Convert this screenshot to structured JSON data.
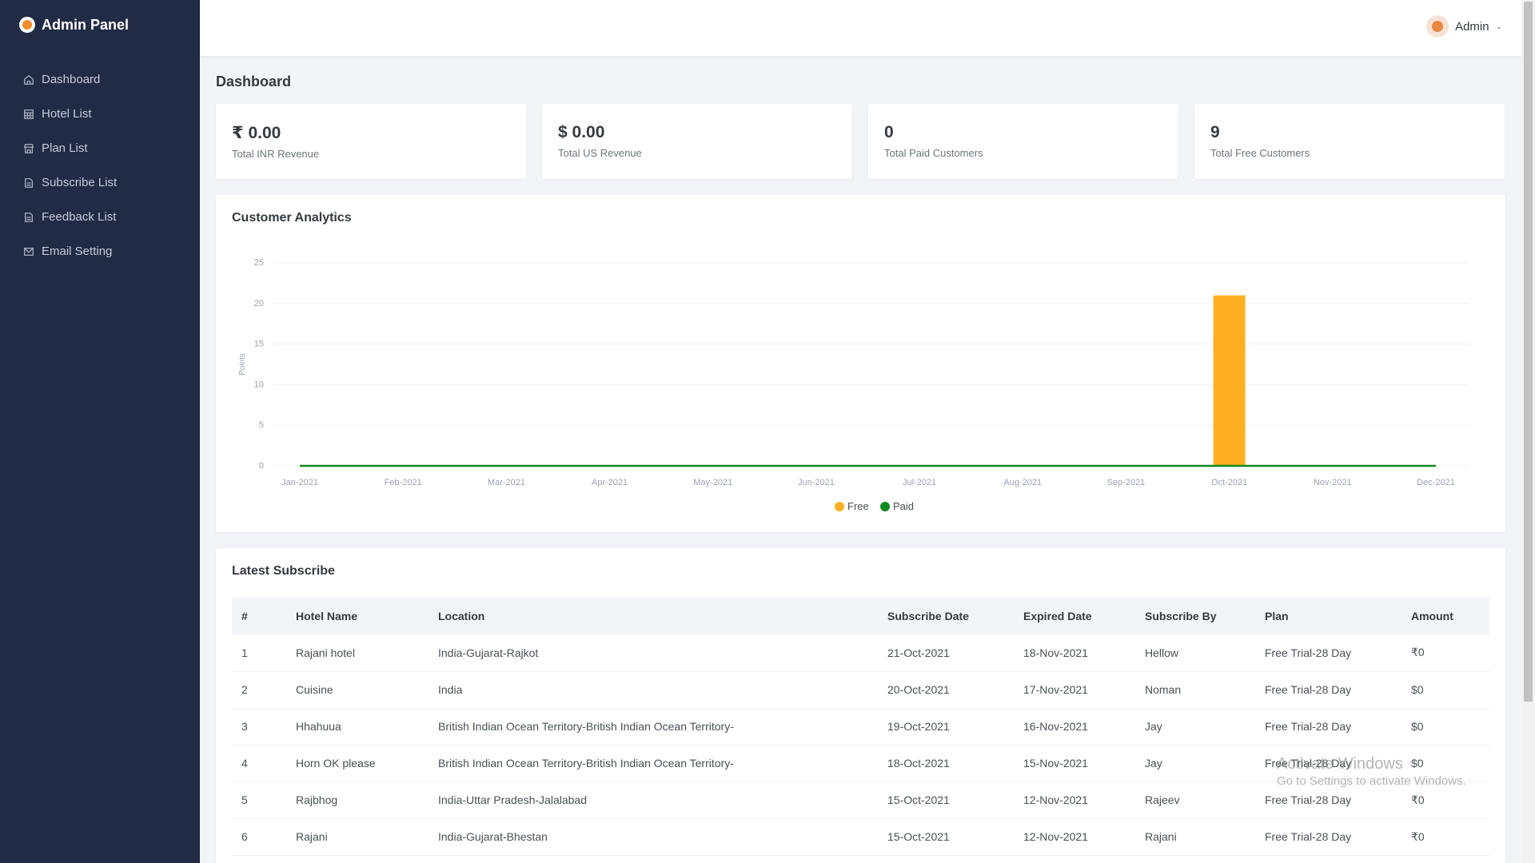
{
  "brand": {
    "title": "Admin Panel",
    "logo_icon": "restaurant-logo-icon"
  },
  "sidebar": {
    "items": [
      {
        "label": "Dashboard",
        "icon": "home-icon"
      },
      {
        "label": "Hotel List",
        "icon": "table-icon"
      },
      {
        "label": "Plan List",
        "icon": "store-icon"
      },
      {
        "label": "Subscribe List",
        "icon": "document-icon"
      },
      {
        "label": "Feedback List",
        "icon": "document-icon"
      },
      {
        "label": "Email Setting",
        "icon": "mail-icon"
      }
    ]
  },
  "header": {
    "user_name": "Admin"
  },
  "page": {
    "title": "Dashboard"
  },
  "stats": [
    {
      "value": "₹ 0.00",
      "label": "Total INR Revenue"
    },
    {
      "value": "$ 0.00",
      "label": "Total US Revenue"
    },
    {
      "value": "0",
      "label": "Total Paid Customers"
    },
    {
      "value": "9",
      "label": "Total Free Customers"
    }
  ],
  "chart_card": {
    "title": "Customer Analytics"
  },
  "chart_data": {
    "type": "bar",
    "title": "",
    "xlabel": "",
    "ylabel": "Points",
    "ylim": [
      0,
      25
    ],
    "yticks": [
      0,
      5,
      10,
      15,
      20,
      25
    ],
    "grid": true,
    "legend_position": "bottom",
    "categories": [
      "Jan-2021",
      "Feb-2021",
      "Mar-2021",
      "Apr-2021",
      "May-2021",
      "Jun-2021",
      "Jul-2021",
      "Aug-2021",
      "Sep-2021",
      "Oct-2021",
      "Nov-2021",
      "Dec-2021"
    ],
    "series": [
      {
        "name": "Free",
        "color": "#ffb022",
        "chart": "bar",
        "values": [
          0,
          0,
          0,
          0,
          0,
          0,
          0,
          0,
          0,
          21,
          0,
          0
        ]
      },
      {
        "name": "Paid",
        "color": "#0f8a1f",
        "chart": "line",
        "values": [
          0,
          0,
          0,
          0,
          0,
          0,
          0,
          0,
          0,
          0,
          0,
          0
        ]
      }
    ]
  },
  "table_card": {
    "title": "Latest Subscribe",
    "columns": [
      "#",
      "Hotel Name",
      "Location",
      "Subscribe Date",
      "Expired Date",
      "Subscribe By",
      "Plan",
      "Amount"
    ],
    "rows": [
      [
        "1",
        "Rajani hotel",
        "India-Gujarat-Rajkot",
        "21-Oct-2021",
        "18-Nov-2021",
        "Hellow",
        "Free Trial-28 Day",
        "₹0"
      ],
      [
        "2",
        "Cuisine",
        "India",
        "20-Oct-2021",
        "17-Nov-2021",
        "Noman",
        "Free Trial-28 Day",
        "$0"
      ],
      [
        "3",
        "Hhahuua",
        "British Indian Ocean Territory-British Indian Ocean Territory-",
        "19-Oct-2021",
        "16-Nov-2021",
        "Jay",
        "Free Trial-28 Day",
        "$0"
      ],
      [
        "4",
        "Horn OK please",
        "British Indian Ocean Territory-British Indian Ocean Territory-",
        "18-Oct-2021",
        "15-Nov-2021",
        "Jay",
        "Free Trial-28 Day",
        "$0"
      ],
      [
        "5",
        "Rajbhog",
        "India-Uttar Pradesh-Jalalabad",
        "15-Oct-2021",
        "12-Nov-2021",
        "Rajeev",
        "Free Trial-28 Day",
        "₹0"
      ],
      [
        "6",
        "Rajani",
        "India-Gujarat-Bhestan",
        "15-Oct-2021",
        "12-Nov-2021",
        "Rajani",
        "Free Trial-28 Day",
        "₹0"
      ]
    ]
  },
  "watermark": {
    "title": "Activate Windows",
    "subtitle": "Go to Settings to activate Windows."
  }
}
